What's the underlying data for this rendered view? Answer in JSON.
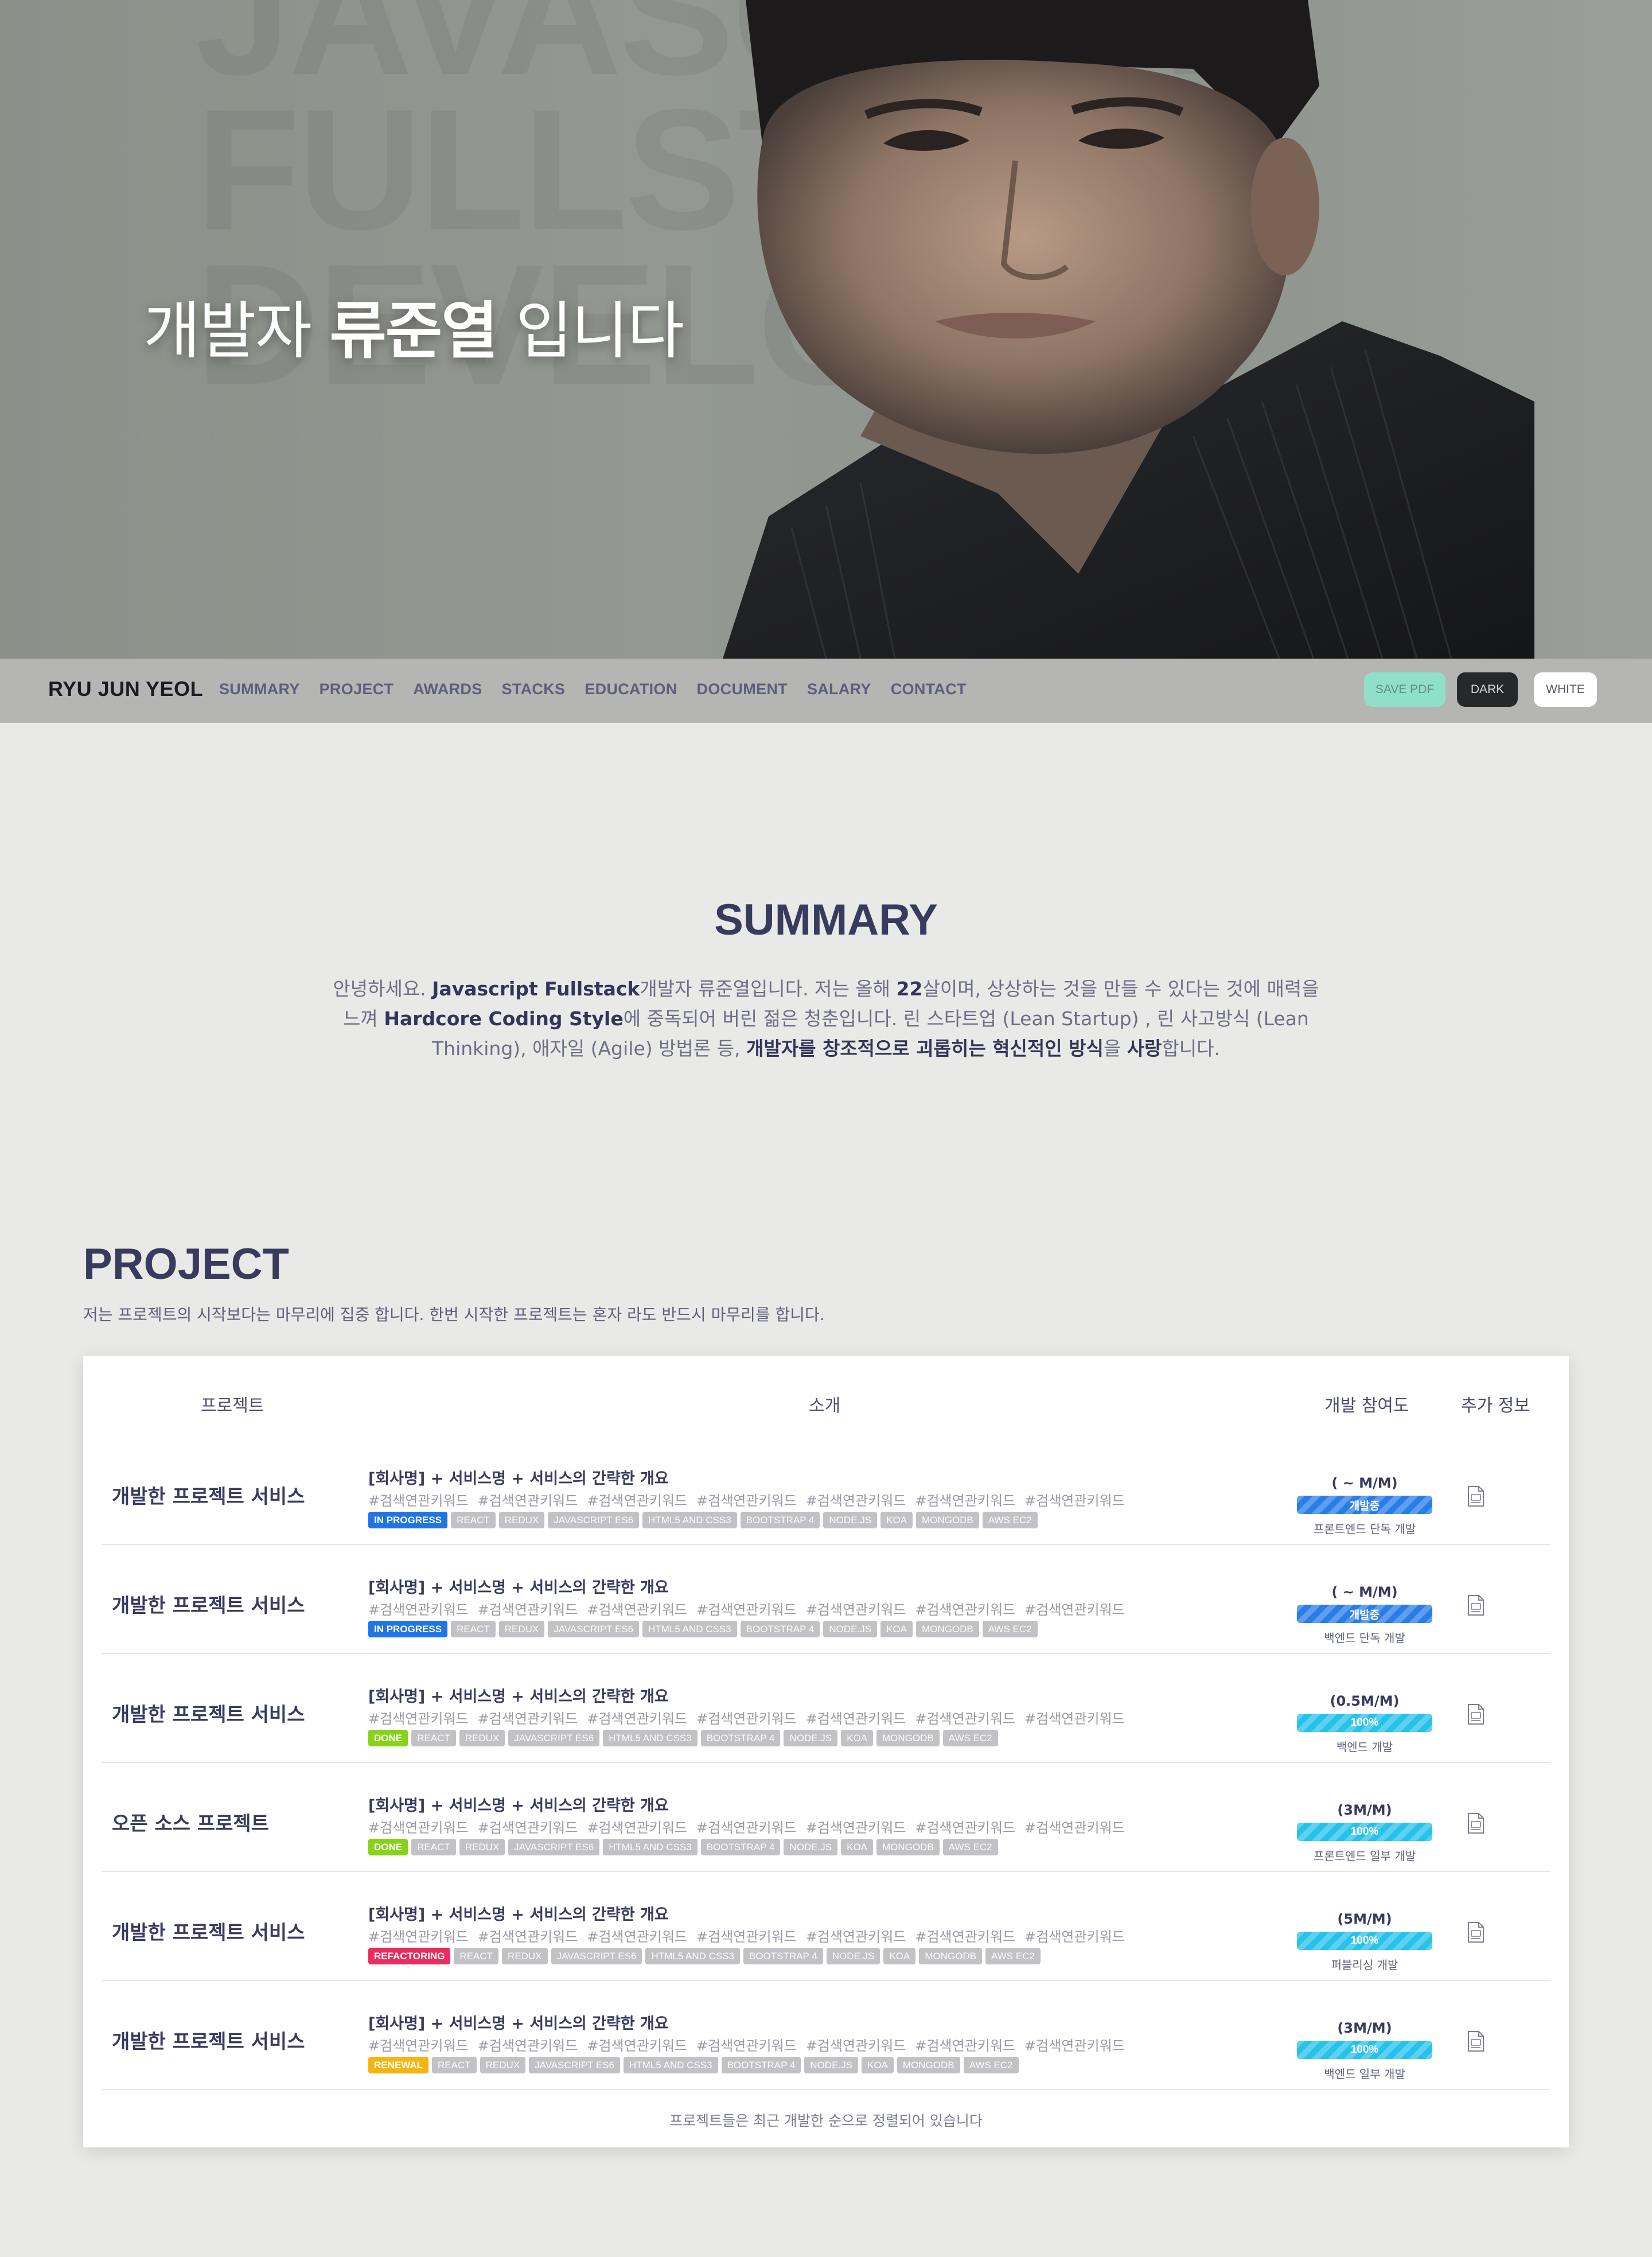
{
  "hero": {
    "bg_words": [
      "JAVASCRIPT",
      "FULLSTACK",
      "DEVELOPER"
    ],
    "title_prefix": "개발자",
    "title_name": "류준열",
    "title_suffix": "입니다"
  },
  "nav": {
    "brand": "RYU JUN YEOL",
    "links": [
      "SUMMARY",
      "PROJECT",
      "AWARDS",
      "STACKS",
      "EDUCATION",
      "DOCUMENT",
      "SALARY",
      "CONTACT"
    ],
    "save_pdf": "SAVE PDF",
    "dark": "DARK",
    "white": "WHITE"
  },
  "summary": {
    "title": "SUMMARY",
    "p1": "안녕하세요. ",
    "b1": "Javascript Fullstack",
    "p2": "개발자 류준열입니다. 저는 올해 ",
    "b2": "22",
    "p3": "살이며, 상상하는 것을 만들 수 있다는 것에 매력을 느껴 ",
    "b3": "Hardcore Coding Style",
    "p4": "에 중독되어 버린 젊은 청춘입니다. 린 스타트업 (Lean Startup) , 린 사고방식 (Lean Thinking), 애자일 (Agile) 방법론 등, ",
    "b4": "개발자를 창조적으로 괴롭히는 혁신적인 방식",
    "p5": "을 ",
    "b5": "사랑",
    "p6": "합니다."
  },
  "project": {
    "title": "PROJECT",
    "description": "저는 프로젝트의 시작보다는 마무리에 집중 합니다. 한번 시작한 프로젝트는 혼자 라도 반드시 마무리를 합니다.",
    "headers": {
      "project": "프로젝트",
      "intro": "소개",
      "participation": "개발 참여도",
      "extra": "추가 정보"
    },
    "footer": "프로젝트들은 최근 개발한 순으로 정렬되어 있습니다",
    "keywords": [
      "#검색연관키워드",
      "#검색연관키워드",
      "#검색연관키워드",
      "#검색연관키워드",
      "#검색연관키워드",
      "#검색연관키워드",
      "#검색연관키워드"
    ],
    "stack_tags": [
      "REACT",
      "REDUX",
      "JAVASCRIPT ES6",
      "HTML5 AND CSS3",
      "BOOTSTRAP 4",
      "NODE.JS",
      "KOA",
      "MONGODB",
      "AWS EC2"
    ],
    "rows": [
      {
        "name": "개발한 프로젝트 서비스",
        "intro": "[회사명] + 서비스명 + 서비스의 간략한 개요",
        "status": "IN PROGRESS",
        "status_color": "#1f74e6",
        "effort": "( ~ M/M)",
        "bar_label": "개발중",
        "bar_color": "#2a7de8",
        "progress": 1.0,
        "role": "프론트엔드 단독 개발"
      },
      {
        "name": "개발한 프로젝트 서비스",
        "intro": "[회사명] + 서비스명 + 서비스의 간략한 개요",
        "status": "IN PROGRESS",
        "status_color": "#1f74e6",
        "effort": "( ~ M/M)",
        "bar_label": "개발중",
        "bar_color": "#2a7de8",
        "progress": 1.0,
        "role": "백엔드 단독 개발"
      },
      {
        "name": "개발한 프로젝트 서비스",
        "intro": "[회사명] + 서비스명 + 서비스의 간략한 개요",
        "status": "DONE",
        "status_color": "#86d317",
        "effort": "(0.5M/M)",
        "bar_label": "100%",
        "bar_color": "#27c2ea",
        "progress": 1.0,
        "role": "백엔드 개발"
      },
      {
        "name": "오픈 소스 프로젝트",
        "intro": "[회사명] + 서비스명 + 서비스의 간략한 개요",
        "status": "DONE",
        "status_color": "#86d317",
        "effort": "(3M/M)",
        "bar_label": "100%",
        "bar_color": "#27c2ea",
        "progress": 1.0,
        "role": "프론트엔드 일부 개발"
      },
      {
        "name": "개발한 프로젝트 서비스",
        "intro": "[회사명] + 서비스명 + 서비스의 간략한 개요",
        "status": "REFACTORING",
        "status_color": "#ec2c5d",
        "effort": "(5M/M)",
        "bar_label": "100%",
        "bar_color": "#27c2ea",
        "progress": 1.0,
        "role": "퍼블리싱 개발"
      },
      {
        "name": "개발한 프로젝트 서비스",
        "intro": "[회사명] + 서비스명 + 서비스의 간략한 개요",
        "status": "RENEWAL",
        "status_color": "#f5b40f",
        "effort": "(3M/M)",
        "bar_label": "100%",
        "bar_color": "#27c2ea",
        "progress": 1.0,
        "role": "백엔드 일부 개발"
      }
    ]
  }
}
